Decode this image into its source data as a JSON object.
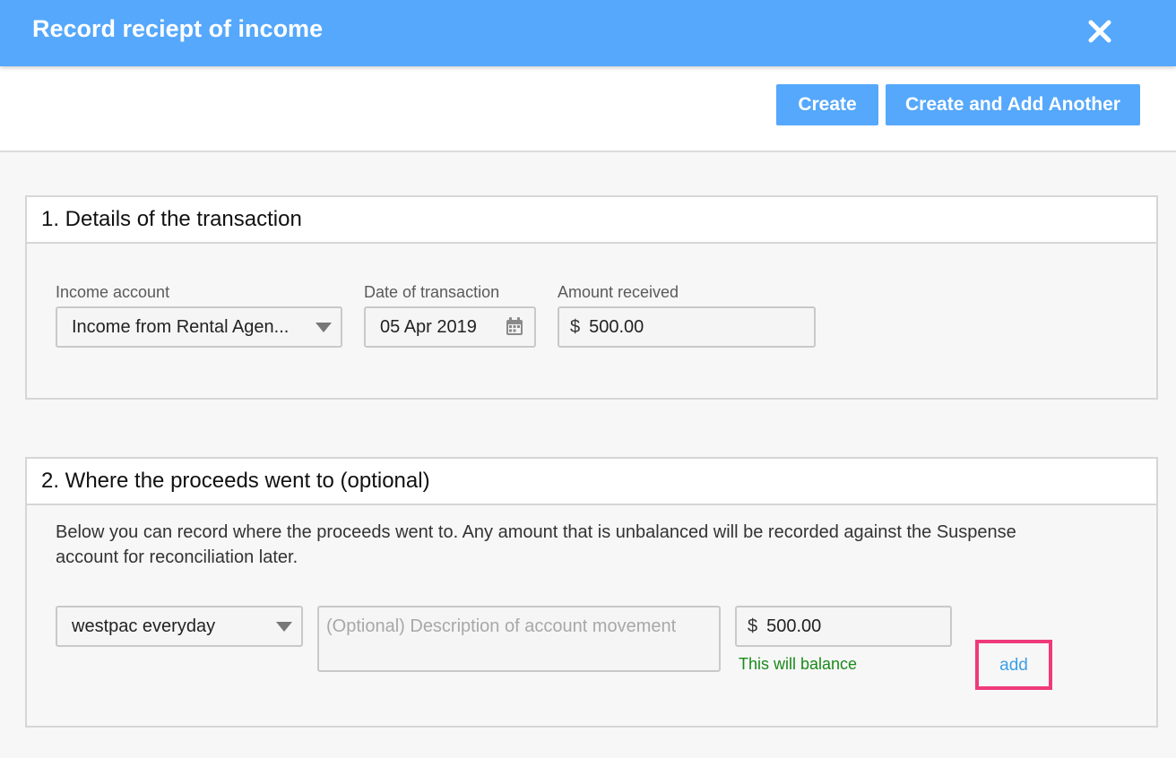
{
  "dialog": {
    "title": "Record reciept of income",
    "close_icon": "close-icon"
  },
  "toolbar": {
    "create_label": "Create",
    "create_another_label": "Create and Add Another"
  },
  "section1": {
    "heading": "1. Details of the transaction",
    "income_account": {
      "label": "Income account",
      "value": "Income from Rental Agen..."
    },
    "date": {
      "label": "Date of transaction",
      "value": "05 Apr 2019",
      "icon": "calendar-icon"
    },
    "amount": {
      "label": "Amount received",
      "currency": "$",
      "value": "500.00"
    }
  },
  "section2": {
    "heading": "2. Where the proceeds went to (optional)",
    "description_line1": "Below you can record where the proceeds went to. Any amount that is unbalanced will be recorded against the Suspense",
    "description_line2": "account for reconciliation later.",
    "account": {
      "value": "westpac everyday"
    },
    "movement_description": {
      "placeholder": "(Optional) Description of account movement"
    },
    "amount": {
      "currency": "$",
      "value": "500.00"
    },
    "balance_note": "This will balance",
    "add_label": "add"
  },
  "colors": {
    "accent": "#55a8fb",
    "success": "#1a8a1a",
    "highlight": "#ef3a7a",
    "link": "#3c9fe8"
  }
}
